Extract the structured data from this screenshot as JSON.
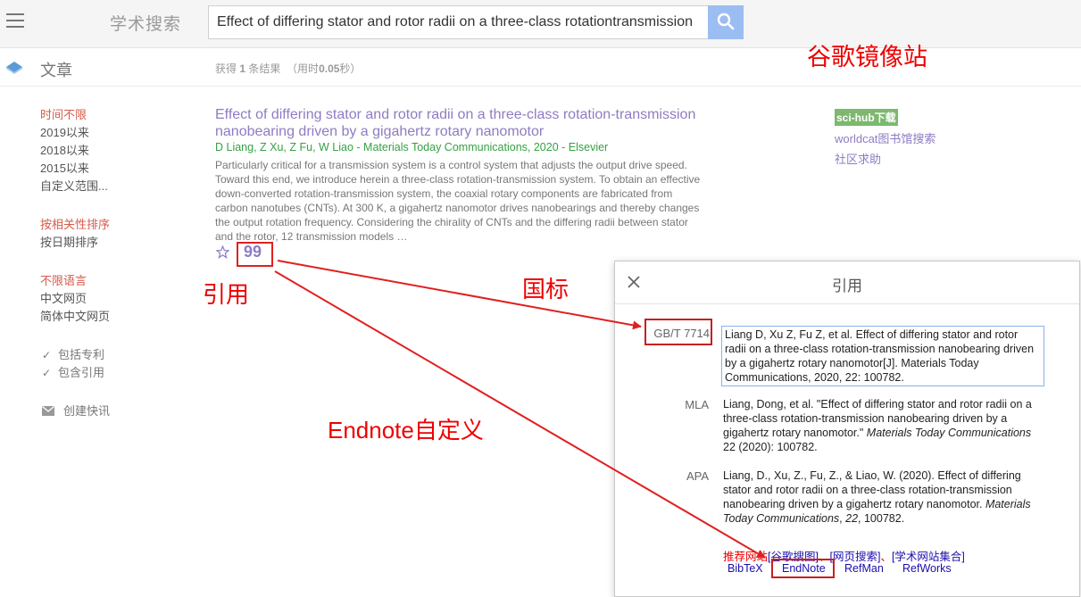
{
  "header": {
    "brand": "学术搜索",
    "search_value": "Effect of differing stator and rotor radii on a three-class rotationtransmission"
  },
  "subheader": {
    "section_label": "文章",
    "stats_prefix": "获得 ",
    "stats_count": "1",
    "stats_suffix": " 条结果",
    "stats_time": "（用时",
    "stats_seconds": "0.05",
    "stats_time_suffix": "秒）"
  },
  "sidebar": {
    "time_filters": [
      "时间不限",
      "2019以来",
      "2018以来",
      "2015以来",
      "自定义范围..."
    ],
    "sort_options": [
      "按相关性排序",
      "按日期排序"
    ],
    "language_options": [
      "不限语言",
      "中文网页",
      "简体中文网页"
    ],
    "checkboxes": [
      "包括专利",
      "包含引用"
    ],
    "alert_label": "创建快讯"
  },
  "result": {
    "title": "Effect of differing stator and rotor radii on a three-class rotation-transmission nanobearing driven by a gigahertz rotary nanomotor",
    "authors": "D Liang, Z Xu, Z Fu, W Liao - Materials Today Communications, 2020 - Elsevier",
    "snippet": "Particularly critical for a transmission system is a control system that adjusts the output drive speed. Toward this end, we introduce herein a three-class rotation-transmission system. To obtain an effective down-converted rotation-transmission system, the coaxial rotary components are fabricated from carbon nanotubes (CNTs). At 300 K, a gigahertz nanomotor drives nanobearings and thereby changes the output rotation frequency. Considering the chirality of CNTs and the differing radii between stator and the rotor, 12 transmission models …",
    "cite_glyph": "99"
  },
  "right_links": {
    "scihub": "sci-hub下载",
    "worldcat": "worldcat图书馆搜索",
    "community": "社区求助"
  },
  "annotations": {
    "mirror": "谷歌镜像站",
    "cite": "引用",
    "gb": "国标",
    "endnote": "Endnote自定义"
  },
  "cite_dialog": {
    "title": "引用",
    "entries": [
      {
        "label": "GB/T 7714",
        "text": "Liang D, Xu Z, Fu Z, et al. Effect of differing stator and rotor radii on a three-class rotation-transmission nanobearing driven by a gigahertz rotary nanomotor[J]. Materials Today Communications, 2020, 22: 100782."
      },
      {
        "label": "MLA",
        "text_plain": "Liang, Dong, et al. \"Effect of differing stator and rotor radii on a three-class rotation-transmission nanobearing driven by a gigahertz rotary nanomotor.\" ",
        "text_italic": "Materials Today Communications",
        "text_tail": " 22 (2020): 100782."
      },
      {
        "label": "APA",
        "text_plain": "Liang, D., Xu, Z., Fu, Z., & Liao, W. (2020). Effect of differing stator and rotor radii on a three-class rotation-transmission nanobearing driven by a gigahertz rotary nanomotor. ",
        "text_italic": "Materials Today Communications",
        "text_tail": ", ",
        "text_italic2": "22",
        "text_tail2": ", 100782."
      }
    ],
    "recommend_prefix": "推荐网站",
    "recommend_links": [
      "[谷歌搜图]",
      "[网页搜索]",
      "[学术网站集合]"
    ],
    "recommend_sep": "、",
    "exports": [
      "BibTeX",
      "EndNote",
      "RefMan",
      "RefWorks"
    ]
  },
  "colors": {
    "link_purple": "#8e7cc3",
    "author_green": "#36a143",
    "annotation_red": "#e00000",
    "search_button": "#9bbdf2"
  }
}
